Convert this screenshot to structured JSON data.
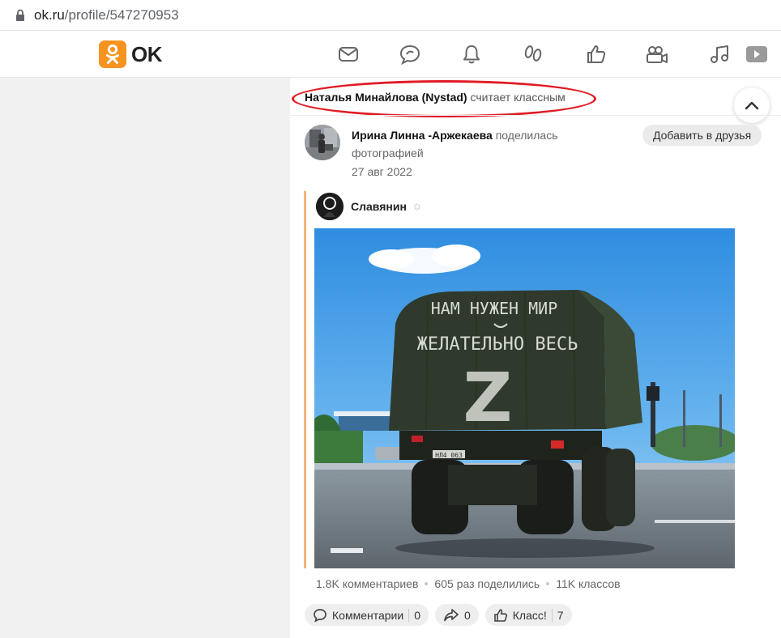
{
  "browser": {
    "url_host": "ok.ru",
    "url_path": "/profile/547270953"
  },
  "header": {
    "logo_text": "OK",
    "nav_icons": [
      "mail-icon",
      "chat-icon",
      "bell-icon",
      "guests-icon",
      "likes-icon",
      "video-icon",
      "music-icon",
      "play-icon"
    ]
  },
  "feed": {
    "klass": {
      "user": "Наталья Минайлова (Nystad)",
      "action": " считает классным"
    },
    "post": {
      "author": "Ирина Линна -Аржекаева",
      "action": " поделилась фотографией",
      "date": "27 авг 2022",
      "add_friend_label": "Добавить в друзья"
    },
    "repost": {
      "group_name": "Славянин",
      "image_text": {
        "line1": "НАМ НУЖЕН МИР",
        "line2": "ЖЕЛАТЕЛЬНО ВЕСЬ",
        "letter": "Z",
        "plate": "НЛ4 063"
      }
    },
    "stats": {
      "comments": "1.8K комментариев",
      "shares": "605 раз поделились",
      "klasses": "11K классов"
    },
    "actions": {
      "comments_label": "Комментарии",
      "comments_count": "0",
      "share_count": "0",
      "klass_label": "Класс!",
      "klass_count": "7"
    }
  },
  "colors": {
    "brand": "#f7931e",
    "highlight_ellipse": "#e01b24",
    "repost_line": "#f7b37a"
  }
}
